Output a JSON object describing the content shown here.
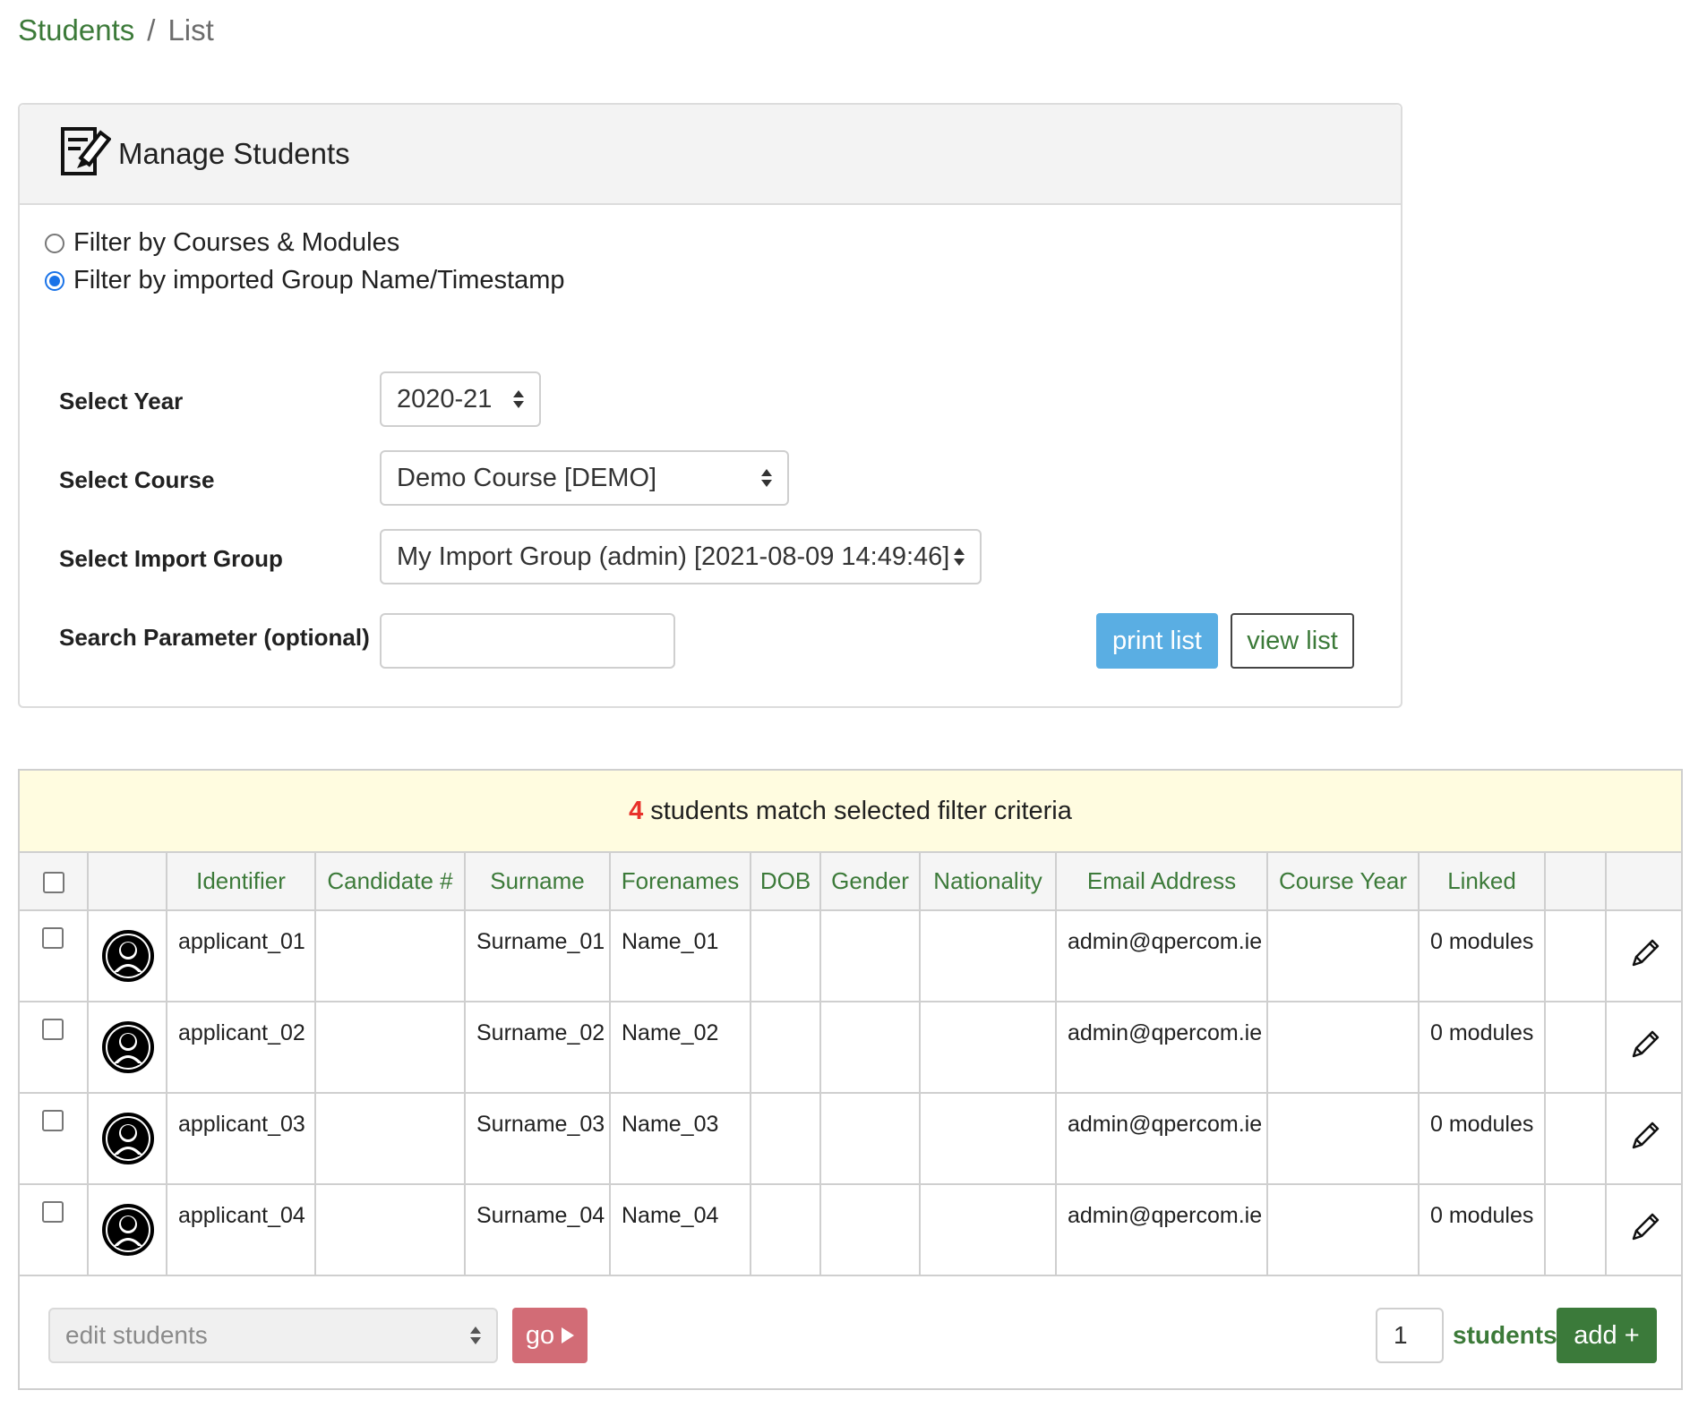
{
  "breadcrumb": {
    "parent": "Students",
    "separator": "/",
    "current": "List"
  },
  "panel": {
    "title": "Manage Students",
    "icon": "manage-document-icon",
    "filters": [
      {
        "label": "Filter by Courses & Modules",
        "checked": false
      },
      {
        "label": "Filter by imported Group Name/Timestamp",
        "checked": true
      }
    ],
    "form": {
      "year_label": "Select Year",
      "year_value": "2020-21",
      "course_label": "Select Course",
      "course_value": "Demo Course [DEMO]",
      "import_group_label": "Select Import Group",
      "import_group_value": "My Import Group (admin) [2021-08-09 14:49:46]",
      "search_label": "Search Parameter (optional)",
      "search_value": ""
    },
    "print_label": "print list",
    "view_label": "view list"
  },
  "results": {
    "count": "4",
    "message": "students match selected filter criteria",
    "columns": [
      "",
      "",
      "Identifier",
      "Candidate #",
      "Surname",
      "Forenames",
      "DOB",
      "Gender",
      "Nationality",
      "Email Address",
      "Course Year",
      "Linked",
      "",
      ""
    ],
    "rows": [
      {
        "identifier": "applicant_01",
        "candidate": "",
        "surname": "Surname_01",
        "forenames": "Name_01",
        "dob": "",
        "gender": "",
        "nationality": "",
        "email": "admin@qpercom.ie",
        "course_year": "",
        "linked": "0 modules"
      },
      {
        "identifier": "applicant_02",
        "candidate": "",
        "surname": "Surname_02",
        "forenames": "Name_02",
        "dob": "",
        "gender": "",
        "nationality": "",
        "email": "admin@qpercom.ie",
        "course_year": "",
        "linked": "0 modules"
      },
      {
        "identifier": "applicant_03",
        "candidate": "",
        "surname": "Surname_03",
        "forenames": "Name_03",
        "dob": "",
        "gender": "",
        "nationality": "",
        "email": "admin@qpercom.ie",
        "course_year": "",
        "linked": "0 modules"
      },
      {
        "identifier": "applicant_04",
        "candidate": "",
        "surname": "Surname_04",
        "forenames": "Name_04",
        "dob": "",
        "gender": "",
        "nationality": "",
        "email": "admin@qpercom.ie",
        "course_year": "",
        "linked": "0 modules"
      }
    ]
  },
  "footer": {
    "bulk_action_placeholder": "edit students",
    "go_label": "go",
    "add_count": "1",
    "add_unit": "students",
    "add_label": "add +"
  },
  "colors": {
    "accent_green": "#3c7a39",
    "print_blue": "#5aaee3",
    "go_red": "#d26c76",
    "add_green": "#3b7a3a",
    "banner_yellow": "#fffce0",
    "count_red": "#e8312a"
  }
}
